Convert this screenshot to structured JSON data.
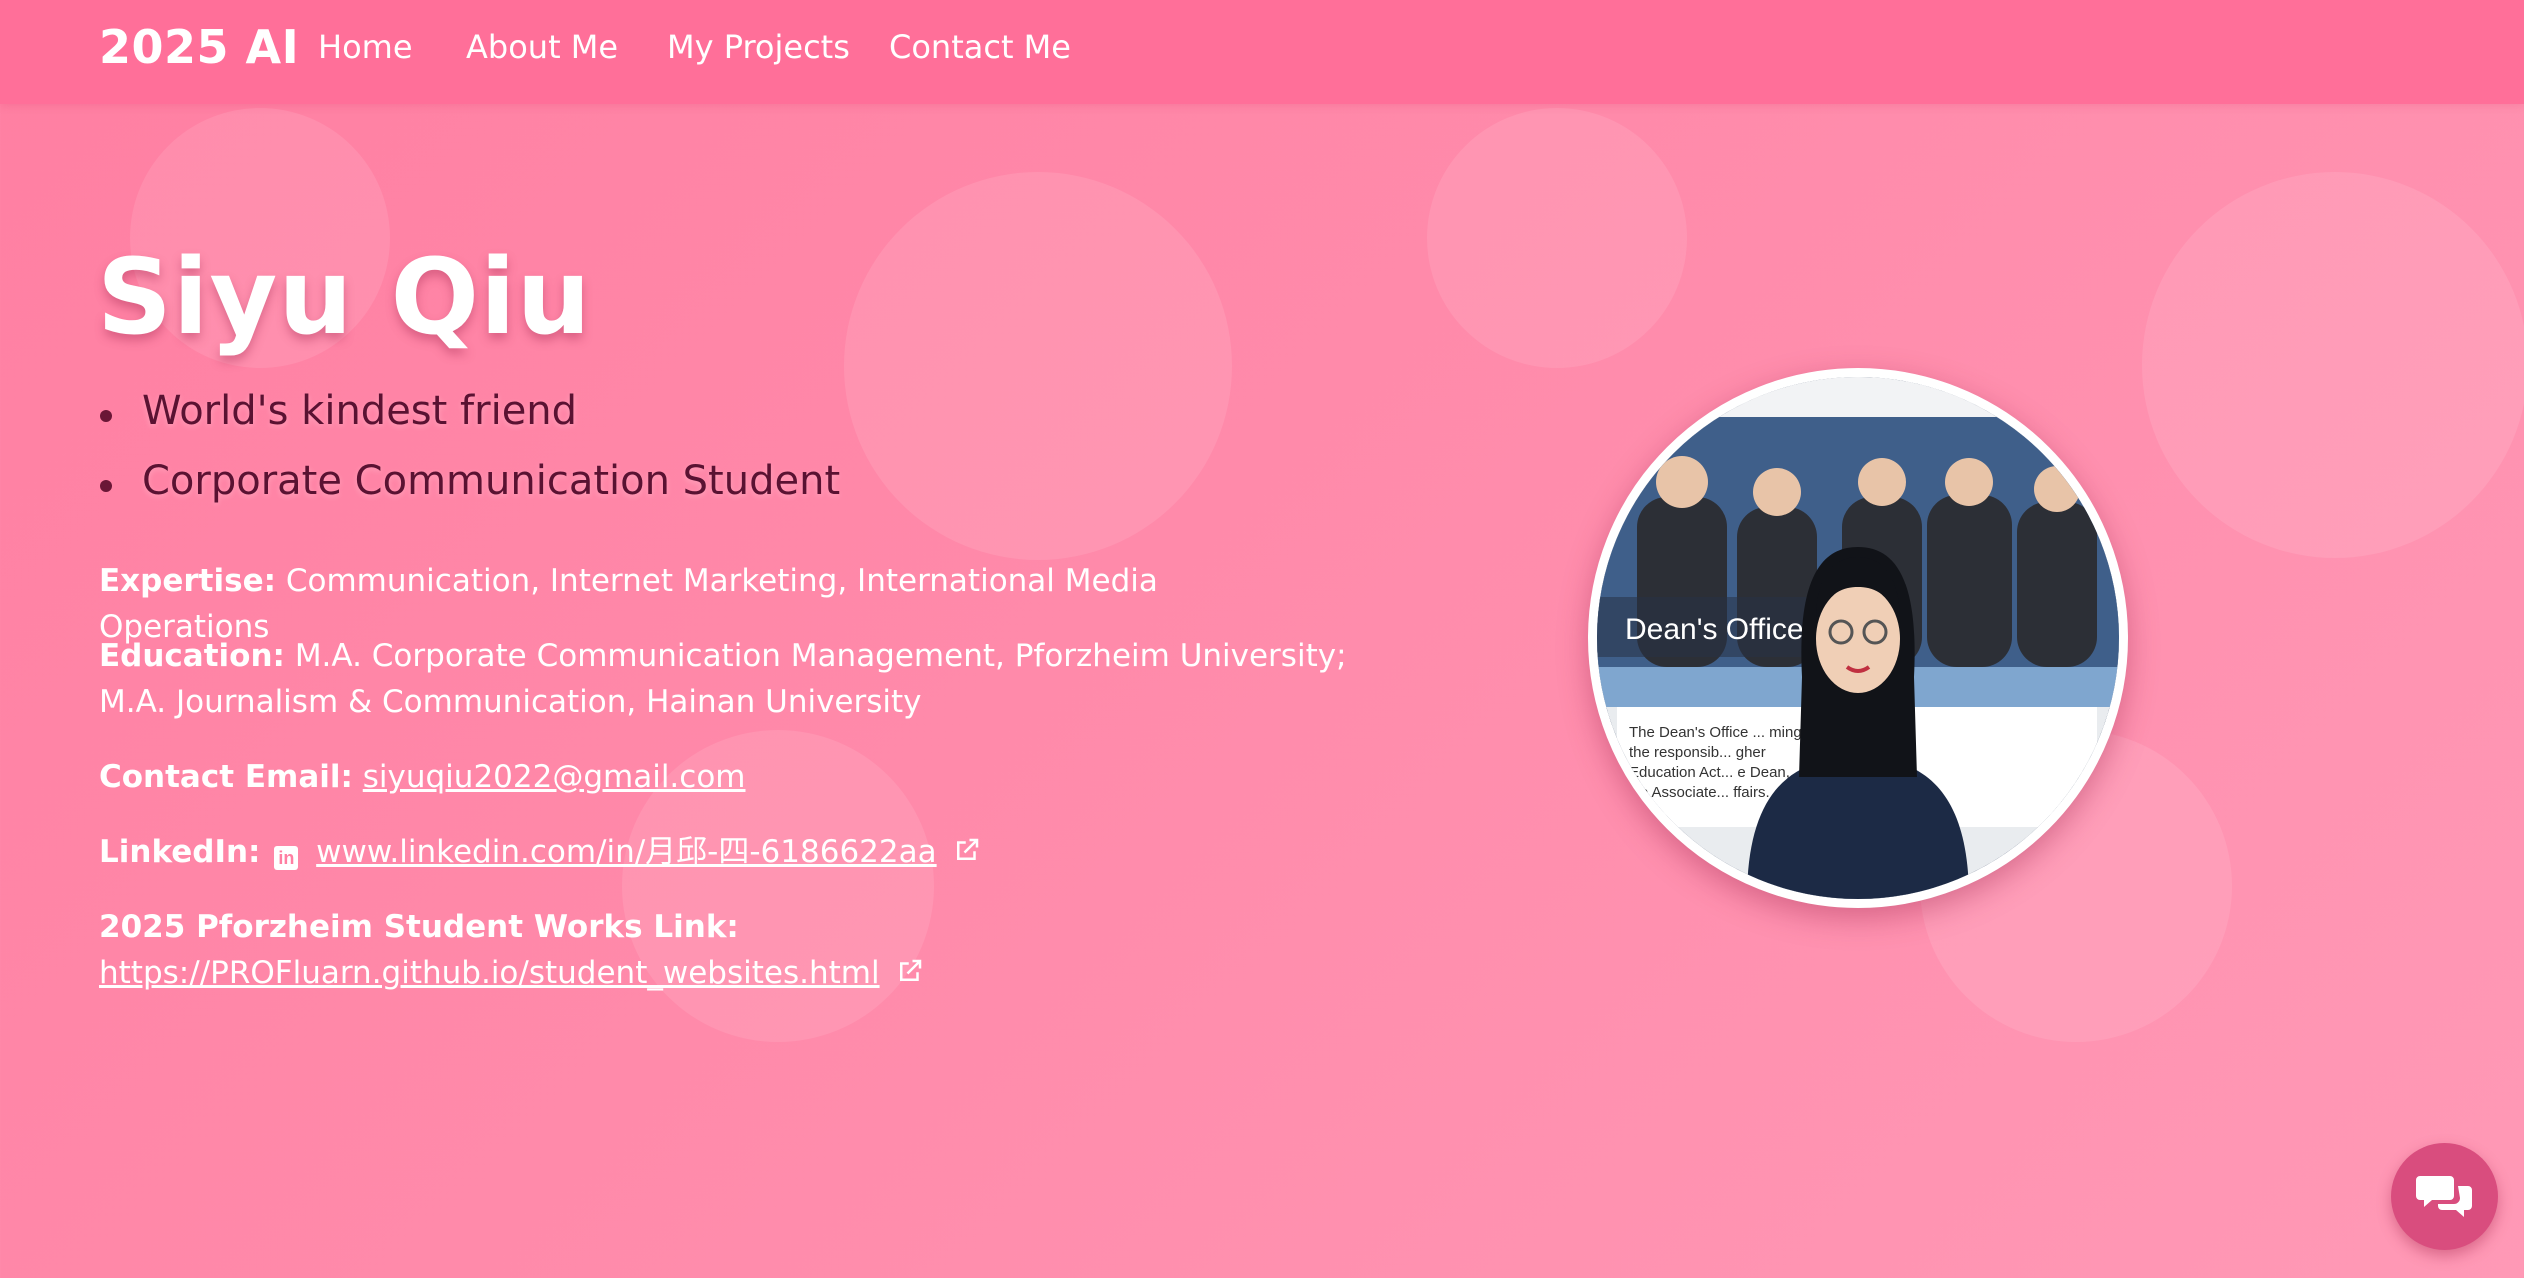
{
  "navbar": {
    "brand": "2025 AI",
    "links": [
      "Home",
      "About Me",
      "My Projects",
      "Contact Me"
    ]
  },
  "hero": {
    "name": "Siyu Qiu",
    "taglines": [
      "World's kindest friend",
      "Corporate Communication Student"
    ]
  },
  "info": {
    "expertise_label": "Expertise:",
    "expertise_value": "Communication, Internet Marketing, International Media Operations",
    "education_label": "Education:",
    "education_value": "M.A. Corporate Communication Management, Pforzheim University; M.A. Journalism & Communication, Hainan University",
    "email_label": "Contact Email:",
    "email_value": "siyuqiu2022@gmail.com",
    "linkedin_label": "LinkedIn:",
    "linkedin_value": "www.linkedin.com/in/月邱-四-6186622aa",
    "works_label": "2025 Pforzheim Student Works Link:",
    "works_value": "https://PROFluarn.github.io/student_websites.html"
  },
  "portrait": {
    "sign_text": "Dean's Office",
    "board_lines": [
      "The Dean's Office ... ming",
      "the responsib... gher",
      "Education Act... e Dean,",
      "wo Associate... ffairs."
    ]
  },
  "icons": {
    "external_link": "external-link-icon",
    "linkedin": "linkedin-icon",
    "chat": "chat-bubbles-icon"
  },
  "colors": {
    "navbar_bg": "#ff6f99",
    "page_bg": "#ff8aaa",
    "tagline_text": "#5a1232",
    "chat_button": "#d94d7e"
  }
}
